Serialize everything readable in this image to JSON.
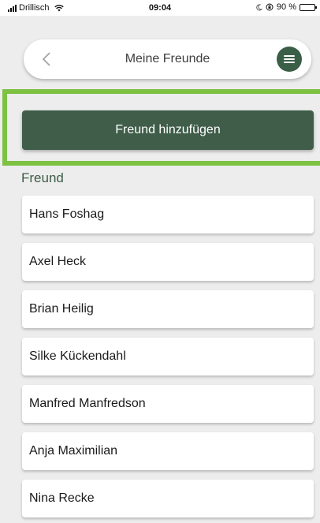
{
  "status_bar": {
    "carrier": "Drillisch",
    "time": "09:04",
    "battery": "90 %"
  },
  "header": {
    "title": "Meine Freunde",
    "back_icon": "chevron-left-icon",
    "menu_icon": "menu-icon"
  },
  "add_button_label": "Freund hinzufügen",
  "section_label": "Freund",
  "friends": [
    {
      "name": "Hans Foshag"
    },
    {
      "name": "Axel Heck"
    },
    {
      "name": "Brian Heilig"
    },
    {
      "name": "Silke Kückendahl"
    },
    {
      "name": "Manfred Manfredson"
    },
    {
      "name": "Anja Maximilian"
    },
    {
      "name": "Nina Recke"
    }
  ],
  "colors": {
    "primary": "#3f5d49",
    "highlight": "#7dc242",
    "background": "#ededed"
  }
}
